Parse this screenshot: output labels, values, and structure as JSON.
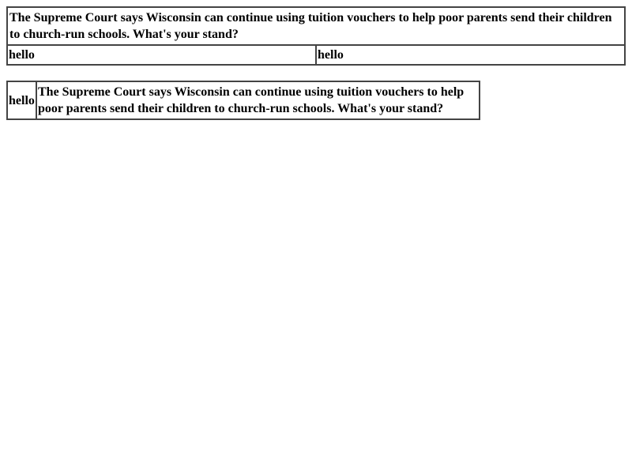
{
  "table_one": {
    "question": "The Supreme Court says Wisconsin can continue using tuition vouchers to help poor parents send their children to church-run schools. What's your stand?",
    "cell_left": "hello",
    "cell_right": "hello"
  },
  "table_two": {
    "label": "hello",
    "question": "The Supreme Court says Wisconsin can continue using tuition vouchers to help poor parents send their children to church-run schools. What's your stand?"
  }
}
